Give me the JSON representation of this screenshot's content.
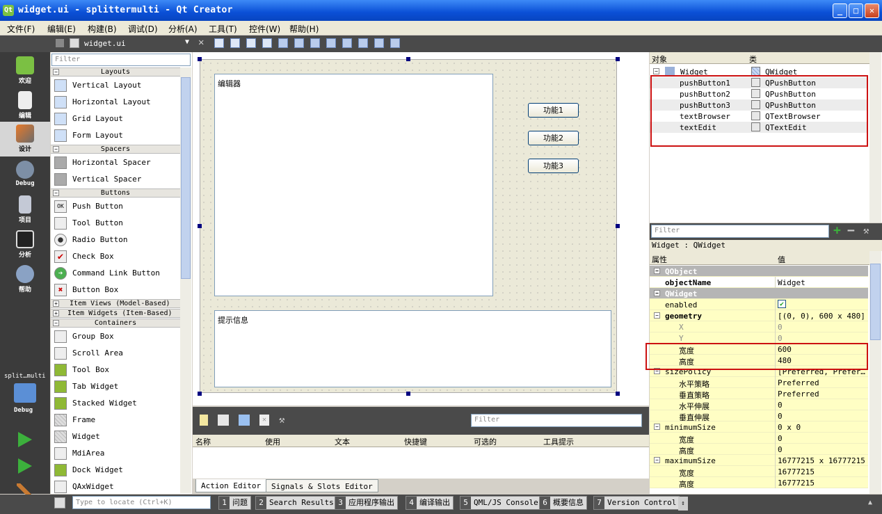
{
  "window": {
    "title": "widget.ui - splittermulti - Qt Creator",
    "app_icon": "Qt"
  },
  "menubar": [
    "文件(F)",
    "编辑(E)",
    "构建(B)",
    "调试(D)",
    "分析(A)",
    "工具(T)",
    "控件(W)",
    "帮助(H)"
  ],
  "editor": {
    "file_name": "widget.ui"
  },
  "modes": [
    {
      "label": "欢迎",
      "icon": "qt-logo-icon"
    },
    {
      "label": "编辑",
      "icon": "edit-document-icon"
    },
    {
      "label": "设计",
      "icon": "design-brush-icon"
    },
    {
      "label": "Debug",
      "icon": "debug-bug-icon"
    },
    {
      "label": "项目",
      "icon": "project-folder-icon"
    },
    {
      "label": "分析",
      "icon": "analyze-chart-icon"
    },
    {
      "label": "帮助",
      "icon": "help-icon"
    }
  ],
  "kit": {
    "project": "split…multi",
    "mode": "Debug"
  },
  "widgetbox": {
    "filter_placeholder": "Filter",
    "categories": {
      "layouts": "Layouts",
      "spacers": "Spacers",
      "buttons": "Buttons",
      "item_views": "Item Views (Model-Based)",
      "item_widgets": "Item Widgets (Item-Based)",
      "containers": "Containers"
    },
    "items": {
      "vertical_layout": "Vertical Layout",
      "horizontal_layout": "Horizontal Layout",
      "grid_layout": "Grid Layout",
      "form_layout": "Form Layout",
      "horizontal_spacer": "Horizontal Spacer",
      "vertical_spacer": "Vertical Spacer",
      "push_button": "Push Button",
      "tool_button": "Tool Button",
      "radio_button": "Radio Button",
      "check_box": "Check Box",
      "command_link_button": "Command Link Button",
      "button_box": "Button Box",
      "group_box": "Group Box",
      "scroll_area": "Scroll Area",
      "tool_box": "Tool Box",
      "tab_widget": "Tab Widget",
      "stacked_widget": "Stacked Widget",
      "frame": "Frame",
      "widget": "Widget",
      "mdi_area": "MdiArea",
      "dock_widget": "Dock Widget",
      "qax_widget": "QAxWidget"
    }
  },
  "form": {
    "textedit_text": "编辑器",
    "textbrowser_text": "提示信息",
    "buttons": [
      "功能1",
      "功能2",
      "功能3"
    ]
  },
  "action_editor": {
    "filter_placeholder": "Filter",
    "columns": [
      "名称",
      "使用",
      "文本",
      "快捷键",
      "可选的",
      "工具提示"
    ],
    "tabs": [
      "Action Editor",
      "Signals & Slots Editor"
    ]
  },
  "object_inspector": {
    "col_object": "对象",
    "col_class": "类",
    "rows": [
      {
        "name": "Widget",
        "class": "QWidget"
      },
      {
        "name": "pushButton1",
        "class": "QPushButton"
      },
      {
        "name": "pushButton2",
        "class": "QPushButton"
      },
      {
        "name": "pushButton3",
        "class": "QPushButton"
      },
      {
        "name": "textBrowser",
        "class": "QTextBrowser"
      },
      {
        "name": "textEdit",
        "class": "QTextEdit"
      }
    ]
  },
  "property_editor": {
    "filter_placeholder": "Filter",
    "class_label": "Widget : QWidget",
    "col_property": "属性",
    "col_value": "值",
    "rows": [
      {
        "name": "QObject",
        "value": ""
      },
      {
        "name": "objectName",
        "value": "Widget"
      },
      {
        "name": "QWidget",
        "value": ""
      },
      {
        "name": "enabled",
        "value": "✔"
      },
      {
        "name": "geometry",
        "value": "[(0, 0), 600 x 480]"
      },
      {
        "name": "X",
        "value": "0"
      },
      {
        "name": "Y",
        "value": "0"
      },
      {
        "name": "宽度",
        "value": "600"
      },
      {
        "name": "高度",
        "value": "480"
      },
      {
        "name": "sizePolicy",
        "value": "[Preferred, Prefer…"
      },
      {
        "name": "水平策略",
        "value": "Preferred"
      },
      {
        "name": "垂直策略",
        "value": "Preferred"
      },
      {
        "name": "水平伸展",
        "value": "0"
      },
      {
        "name": "垂直伸展",
        "value": "0"
      },
      {
        "name": "minimumSize",
        "value": "0 x 0"
      },
      {
        "name": "宽度",
        "value": "0"
      },
      {
        "name": "高度",
        "value": "0"
      },
      {
        "name": "maximumSize",
        "value": "16777215 x 16777215"
      },
      {
        "name": "宽度",
        "value": "16777215"
      },
      {
        "name": "高度",
        "value": "16777215"
      }
    ]
  },
  "statusbar": {
    "locate_placeholder": "Type to locate (Ctrl+K)",
    "tabs": [
      {
        "num": "1",
        "label": "问题"
      },
      {
        "num": "2",
        "label": "Search Results"
      },
      {
        "num": "3",
        "label": "应用程序输出"
      },
      {
        "num": "4",
        "label": "编译输出"
      },
      {
        "num": "5",
        "label": "QML/JS Console"
      },
      {
        "num": "6",
        "label": "概要信息"
      },
      {
        "num": "7",
        "label": "Version Control"
      }
    ]
  },
  "colors": {
    "highlight_box": "#cc1111",
    "property_row": "#fffec4",
    "titlebar": "#0a4fd6"
  }
}
